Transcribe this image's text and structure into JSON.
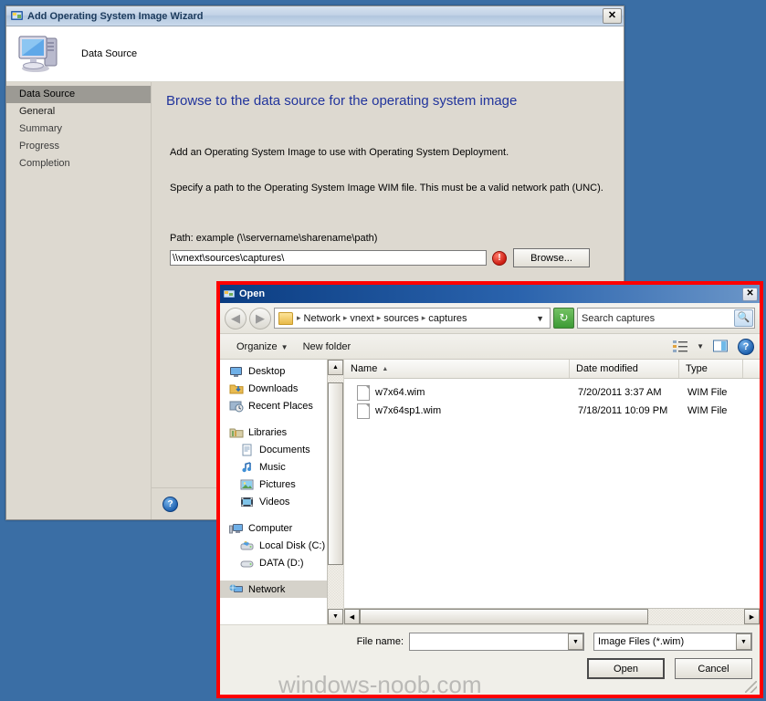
{
  "wizard": {
    "title": "Add Operating System Image Wizard",
    "title_icon": "wizard-app-icon",
    "close_label": "✕",
    "header_label": "Data Source",
    "header_icon": "computer-monitor-icon",
    "nav": [
      {
        "label": "Data Source",
        "state": "selected"
      },
      {
        "label": "General",
        "state": "done"
      },
      {
        "label": "Summary",
        "state": "pending"
      },
      {
        "label": "Progress",
        "state": "pending"
      },
      {
        "label": "Completion",
        "state": "pending"
      }
    ],
    "heading": "Browse to the data source for the operating system image",
    "paragraph1": "Add an Operating System Image to use with Operating System Deployment.",
    "paragraph2": "Specify a path to the Operating System Image WIM file. This must be a valid network path (UNC).",
    "path_label": "Path: example (\\\\servername\\sharename\\path)",
    "path_value": "\\\\vnext\\sources\\captures\\",
    "path_placeholder": "\\\\servername\\sharename\\path",
    "error_glyph": "!",
    "browse_label": "Browse...",
    "help_glyph": "?",
    "heading_color": "#21349c"
  },
  "open_dialog": {
    "title": "Open",
    "title_icon": "open-dialog-icon",
    "close_label": "✕",
    "border_color": "#ff0000",
    "address": {
      "back_glyph": "◀",
      "forward_glyph": "▶",
      "folder_icon": "folder-icon",
      "crumbs": [
        "Network",
        "vnext",
        "sources",
        "captures"
      ],
      "crumb_separator": "▸",
      "dropdown_glyph": "▼",
      "refresh_glyph": "↻"
    },
    "search": {
      "placeholder": "Search captures",
      "value": "Search captures",
      "icon": "search-icon"
    },
    "toolbar": {
      "organize_label": "Organize",
      "organize_caret": "▼",
      "new_folder_label": "New folder",
      "view_icon": "view-list-icon",
      "view_caret": "▼",
      "preview_icon": "preview-pane-icon",
      "help_icon": "help-icon",
      "help_glyph": "?"
    },
    "nav_pane": {
      "items": [
        {
          "label": "Desktop",
          "icon": "desktop-icon",
          "indent": false,
          "selected": false
        },
        {
          "label": "Downloads",
          "icon": "downloads-icon",
          "indent": false,
          "selected": false
        },
        {
          "label": "Recent Places",
          "icon": "recent-places-icon",
          "indent": false,
          "selected": false
        },
        {
          "label": "__GAP__",
          "icon": "",
          "indent": false,
          "selected": false
        },
        {
          "label": "Libraries",
          "icon": "libraries-icon",
          "indent": false,
          "selected": false
        },
        {
          "label": "Documents",
          "icon": "documents-icon",
          "indent": true,
          "selected": false
        },
        {
          "label": "Music",
          "icon": "music-icon",
          "indent": true,
          "selected": false
        },
        {
          "label": "Pictures",
          "icon": "pictures-icon",
          "indent": true,
          "selected": false
        },
        {
          "label": "Videos",
          "icon": "videos-icon",
          "indent": true,
          "selected": false
        },
        {
          "label": "__GAP__",
          "icon": "",
          "indent": false,
          "selected": false
        },
        {
          "label": "Computer",
          "icon": "computer-icon",
          "indent": false,
          "selected": false
        },
        {
          "label": "Local Disk (C:)",
          "icon": "local-disk-icon",
          "indent": true,
          "selected": false
        },
        {
          "label": "DATA (D:)",
          "icon": "data-drive-icon",
          "indent": true,
          "selected": false
        },
        {
          "label": "__GAP__",
          "icon": "",
          "indent": false,
          "selected": false
        },
        {
          "label": "Network",
          "icon": "network-icon",
          "indent": false,
          "selected": true
        }
      ],
      "scroll_up_glyph": "▲",
      "scroll_down_glyph": "▼"
    },
    "file_list": {
      "columns": [
        {
          "label": "Name",
          "sorted": true,
          "sort_glyph": "▲"
        },
        {
          "label": "Date modified",
          "sorted": false,
          "sort_glyph": ""
        },
        {
          "label": "Type",
          "sorted": false,
          "sort_glyph": ""
        }
      ],
      "rows": [
        {
          "name": "w7x64.wim",
          "date_modified": "7/20/2011 3:37 AM",
          "type": "WIM File",
          "icon": "file-icon"
        },
        {
          "name": "w7x64sp1.wim",
          "date_modified": "7/18/2011 10:09 PM",
          "type": "WIM File",
          "icon": "file-icon"
        }
      ],
      "scroll_left_glyph": "◀",
      "scroll_right_glyph": "▶"
    },
    "footer": {
      "file_name_label": "File name:",
      "file_name_value": "",
      "file_name_caret": "▼",
      "file_type_value": "Image Files (*.wim)",
      "file_type_caret": "▼",
      "open_label": "Open",
      "cancel_label": "Cancel"
    }
  },
  "watermark": "windows-noob.com",
  "desktop": {
    "background_color": "#3a6ea5"
  }
}
